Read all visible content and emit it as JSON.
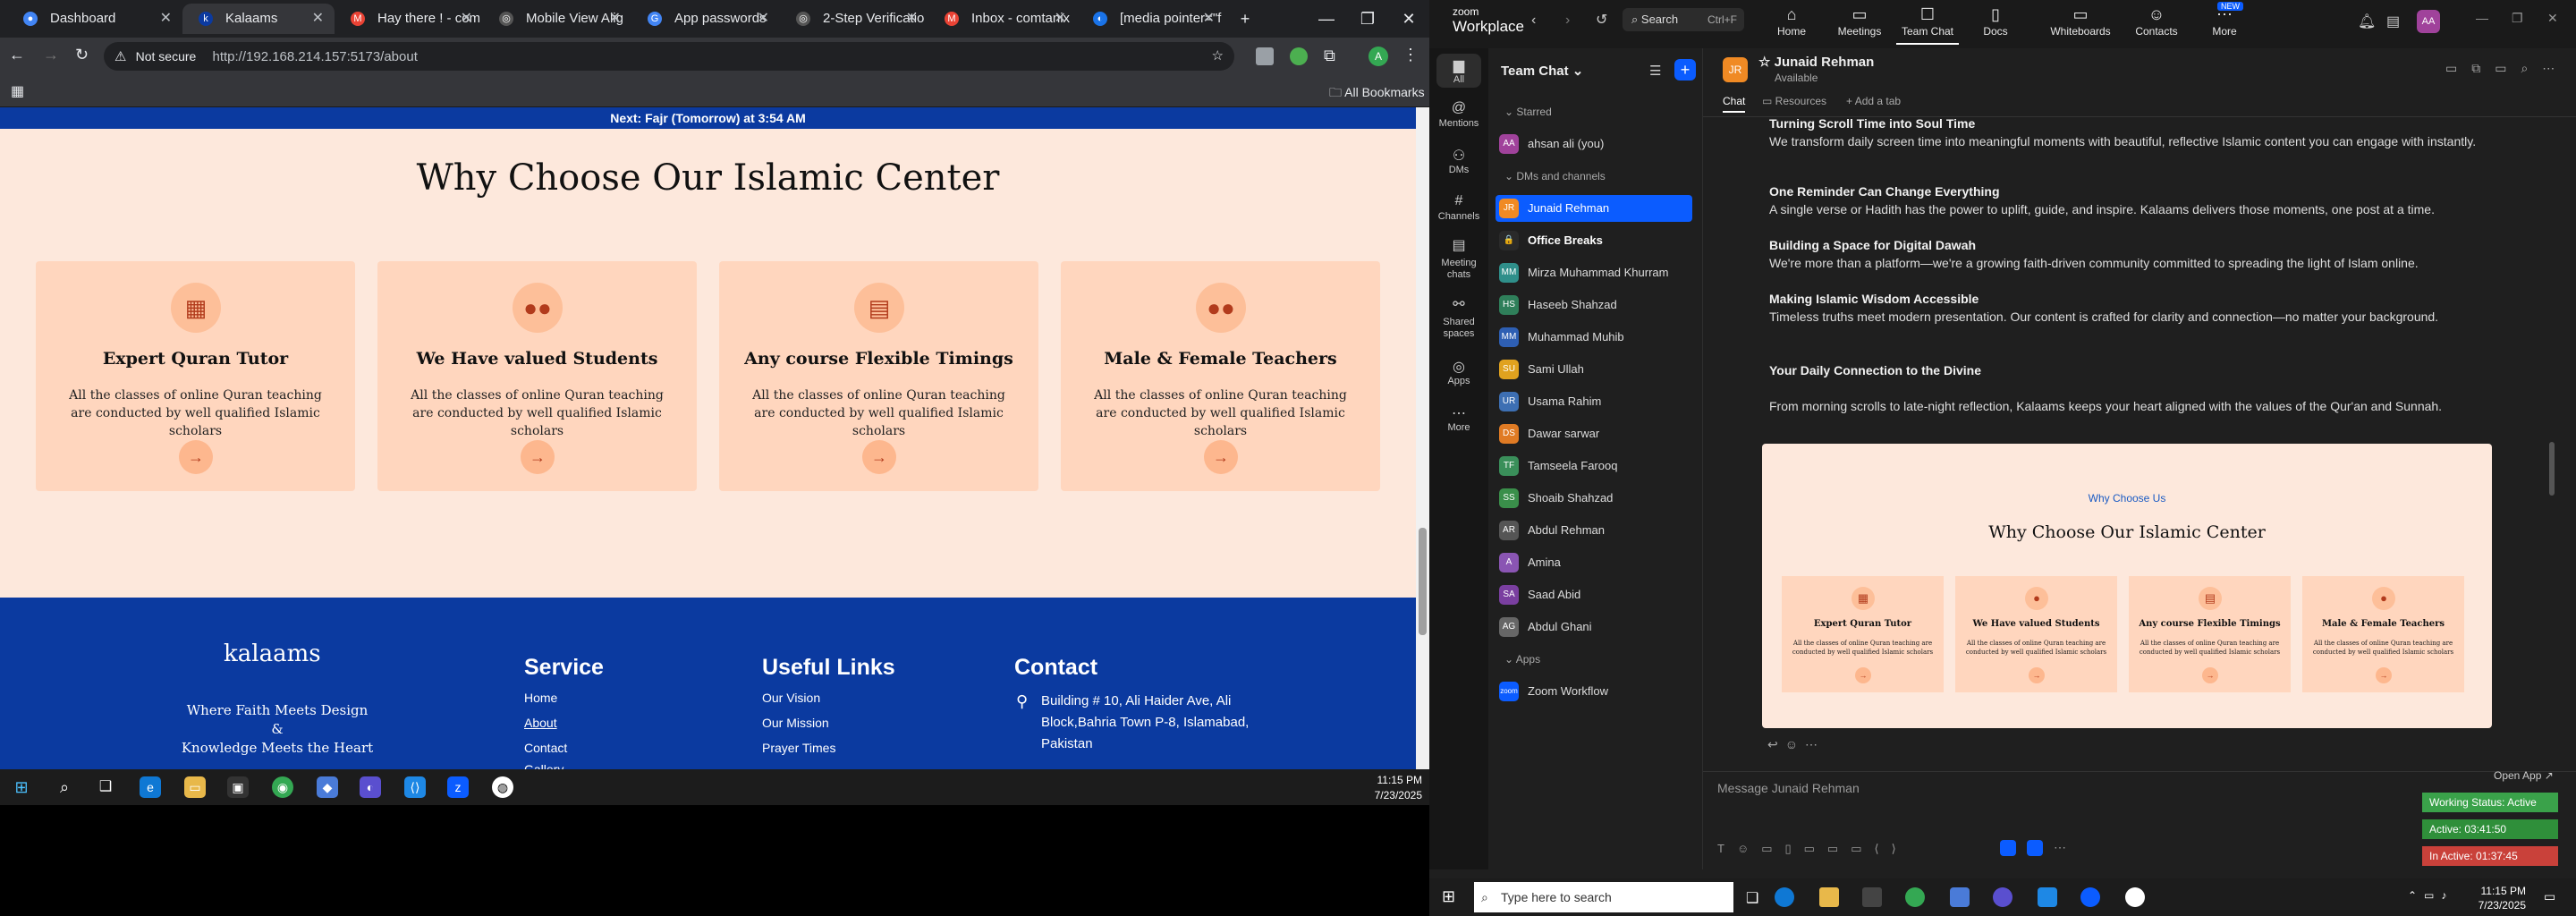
{
  "browser": {
    "tabs": [
      "Dashboard",
      "Kalaams",
      "Hay there ! - com",
      "Mobile View Alig",
      "App passwords",
      "2-Step Verificatio",
      "Inbox - comtanix",
      "[media pointer=\"f"
    ],
    "not_secure": "Not secure",
    "url": "http://192.168.214.157:5173/about",
    "all_bookmarks": "All Bookmarks"
  },
  "site": {
    "banner": "Next: Fajr (Tomorrow) at 3:54 AM",
    "heading": "Why Choose Our Islamic Center",
    "cards": [
      {
        "title": "Expert Quran Tutor",
        "desc": "All the classes of online Quran teaching are conducted by well qualified Islamic scholars",
        "icon": "teacher-board-icon"
      },
      {
        "title": "We Have valued Students",
        "desc": "All the classes of online Quran teaching are conducted by well qualified Islamic scholars",
        "icon": "students-group-icon"
      },
      {
        "title": "Any course Flexible Timings",
        "desc": "All the classes of online Quran teaching are conducted by well qualified Islamic scholars",
        "icon": "calendar-icon"
      },
      {
        "title": "Male & Female Teachers",
        "desc": "All the classes of online Quran teaching are conducted by well qualified Islamic scholars",
        "icon": "male-female-icon"
      }
    ],
    "arrow": "→",
    "footer": {
      "logo": "kalaams",
      "tagline1": "Where Faith Meets Design",
      "tagline2": "&",
      "tagline3": "Knowledge Meets the Heart",
      "service_title": "Service",
      "service_links": [
        "Home",
        "About",
        "Contact",
        "Gallery"
      ],
      "useful_title": "Useful Links",
      "useful_links": [
        "Our Vision",
        "Our Mission",
        "Prayer Times"
      ],
      "contact_title": "Contact",
      "address": "Building # 10, Ali Haider Ave, Ali Block,Bahria Town P-8, Islamabad, Pakistan"
    }
  },
  "taskbar_left": {
    "time": "11:15 PM",
    "date": "7/23/2025"
  },
  "zoom": {
    "brand_top": "zoom",
    "brand": "Workplace",
    "search": "Search",
    "search_shortcut": "Ctrl+F",
    "nav": [
      "Home",
      "Meetings",
      "Team Chat",
      "Docs",
      "Whiteboards",
      "Contacts",
      "More"
    ],
    "nav_new_badge": "NEW",
    "side": [
      "All",
      "Mentions",
      "DMs",
      "Channels",
      "Meeting chats",
      "Shared spaces",
      "Apps",
      "More"
    ],
    "list_title": "Team Chat",
    "sections": {
      "starred": "Starred",
      "dms": "DMs and channels",
      "apps": "Apps"
    },
    "starred": [
      {
        "name": "ahsan ali (you)",
        "init": "AA"
      }
    ],
    "contacts": [
      {
        "name": "Junaid Rehman",
        "init": "JR"
      },
      {
        "name": "Office Breaks",
        "init": "🔒"
      },
      {
        "name": "Mirza Muhammad Khurram",
        "init": "MM"
      },
      {
        "name": "Haseeb Shahzad",
        "init": "HS"
      },
      {
        "name": "Muhammad Muhib",
        "init": "MM"
      },
      {
        "name": "Sami Ullah",
        "init": "SU"
      },
      {
        "name": "Usama Rahim",
        "init": "UR"
      },
      {
        "name": "Dawar sarwar",
        "init": "DS"
      },
      {
        "name": "Tamseela Farooq",
        "init": "TF"
      },
      {
        "name": "Shoaib Shahzad",
        "init": "SS"
      },
      {
        "name": "Abdul Rehman",
        "init": "AR"
      },
      {
        "name": "Amina",
        "init": "A"
      },
      {
        "name": "Saad Abid",
        "init": "SA"
      },
      {
        "name": "Abdul Ghani",
        "init": "AG"
      }
    ],
    "apps": [
      {
        "name": "Zoom Workflow",
        "init": "zoom"
      }
    ],
    "chat_name": "Junaid Rehman",
    "chat_status": "Available",
    "chat_tabs": [
      "Chat",
      "Resources",
      "Add a tab"
    ],
    "messages": [
      {
        "title": "Turning Scroll Time into Soul Time",
        "body": "We transform daily screen time into meaningful moments with beautiful, reflective Islamic content you can engage with instantly."
      },
      {
        "title": "One Reminder Can Change Everything",
        "body": "A single verse or Hadith has the power to uplift, guide, and inspire. Kalaams delivers those moments, one post at a time."
      },
      {
        "title": "Building a Space for Digital Dawah",
        "body": "We're more than a platform—we're a growing faith-driven community committed to spreading the light of Islam online."
      },
      {
        "title": "Making Islamic Wisdom Accessible",
        "body": "Timeless truths meet modern presentation. Our content is crafted for clarity and connection—no matter your background."
      },
      {
        "title": "Your Daily Connection to the Divine",
        "body": ""
      },
      {
        "title": "",
        "body": "From morning scrolls to late-night reflection, Kalaams keeps your heart aligned with the values of the Qur'an and Sunnah."
      }
    ],
    "preview": {
      "kicker": "Why Choose Us",
      "heading": "Why Choose Our Islamic Center"
    },
    "composer_placeholder": "Message Junaid Rehman",
    "open_app": "Open App ↗",
    "status": {
      "working": "Working Status: Active",
      "active": "Active: 03:41:50",
      "inactive": "In Active: 01:37:45"
    },
    "avatar": "AA",
    "search_windows": "Type here to search",
    "time": "11:15 PM",
    "date": "7/23/2025",
    "colors": {
      "working": "#3aa24a",
      "active": "#2f8f3a",
      "inactive": "#c9413a",
      "accent": "#0b5cff"
    }
  }
}
